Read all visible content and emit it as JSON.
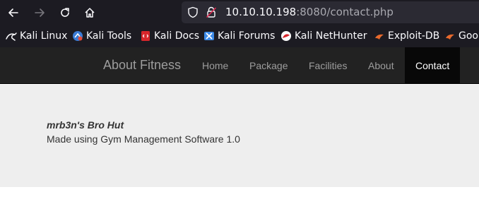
{
  "browser": {
    "url_host": "10.10.10.198",
    "url_rest": ":8080/contact.php"
  },
  "bookmarks": [
    {
      "label": "Kali Linux",
      "icon": "kali-linux-icon"
    },
    {
      "label": "Kali Tools",
      "icon": "kali-tools-icon"
    },
    {
      "label": "Kali Docs",
      "icon": "kali-docs-icon"
    },
    {
      "label": "Kali Forums",
      "icon": "kali-forums-icon"
    },
    {
      "label": "Kali NetHunter",
      "icon": "kali-nethunter-icon"
    },
    {
      "label": "Exploit-DB",
      "icon": "exploit-db-icon"
    },
    {
      "label": "Goo",
      "icon": "google-hacking-db-icon"
    }
  ],
  "site_nav": {
    "brand": "About Fitness",
    "links": [
      "Home",
      "Package",
      "Facilities",
      "About",
      "Contact"
    ],
    "active": "Contact"
  },
  "content": {
    "site_name": "mrb3n's Bro Hut",
    "subtitle": "Made using Gym Management Software 1.0"
  },
  "colors": {
    "toolbar_bg": "#1c1b22",
    "navbar_bg": "#222222",
    "content_bg": "#eeeeee"
  }
}
